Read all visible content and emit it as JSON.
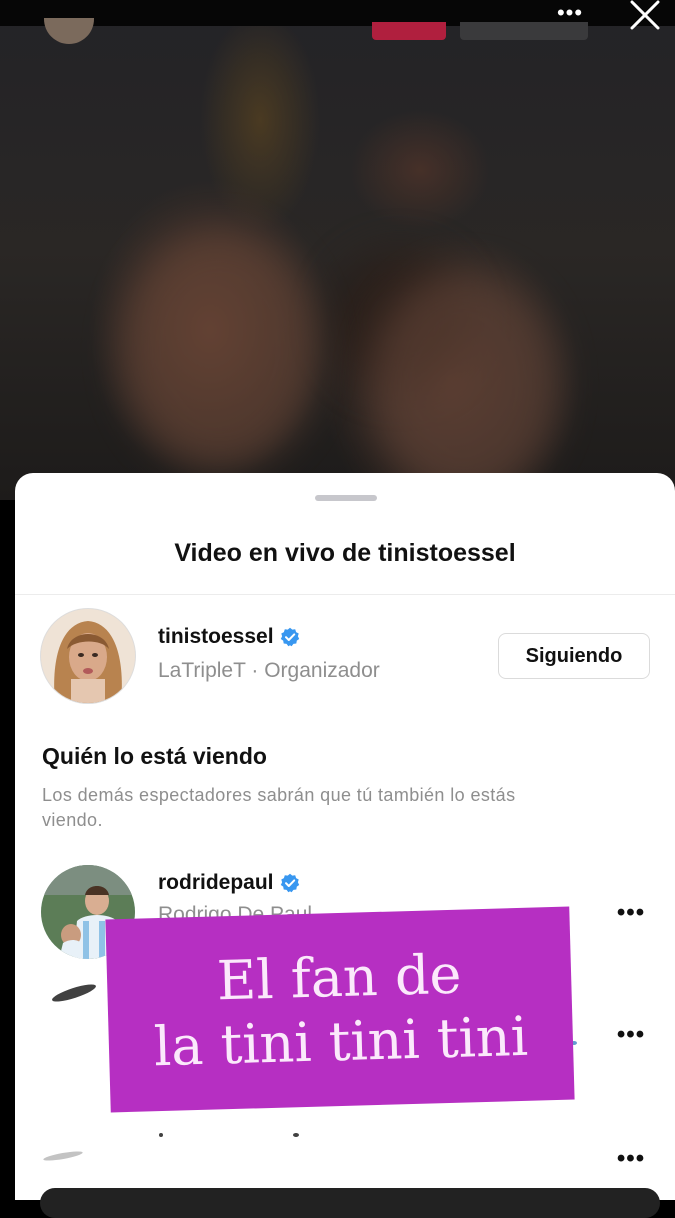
{
  "sheet": {
    "title": "Video en vivo de tinistoessel"
  },
  "host": {
    "username": "tinistoessel",
    "verified": true,
    "subtitle": "LaTripleT · Organizador",
    "follow_button": "Siguiendo"
  },
  "viewers_section": {
    "title": "Quién lo está viendo",
    "description": "Los demás espectadores sabrán que tú también lo estás viendo."
  },
  "viewers": [
    {
      "username": "rodridepaul",
      "verified": true,
      "full_name": "Rodrigo De Paul"
    }
  ],
  "overlay_sticker": {
    "line1": "El fan de",
    "line2": "la tini tini tini",
    "color": "#b62fc2"
  },
  "colors": {
    "verified_blue": "#3897f0",
    "live_red": "#b01f3e"
  },
  "icons": [
    "more-horizontal-icon",
    "close-icon",
    "verified-badge-icon"
  ]
}
